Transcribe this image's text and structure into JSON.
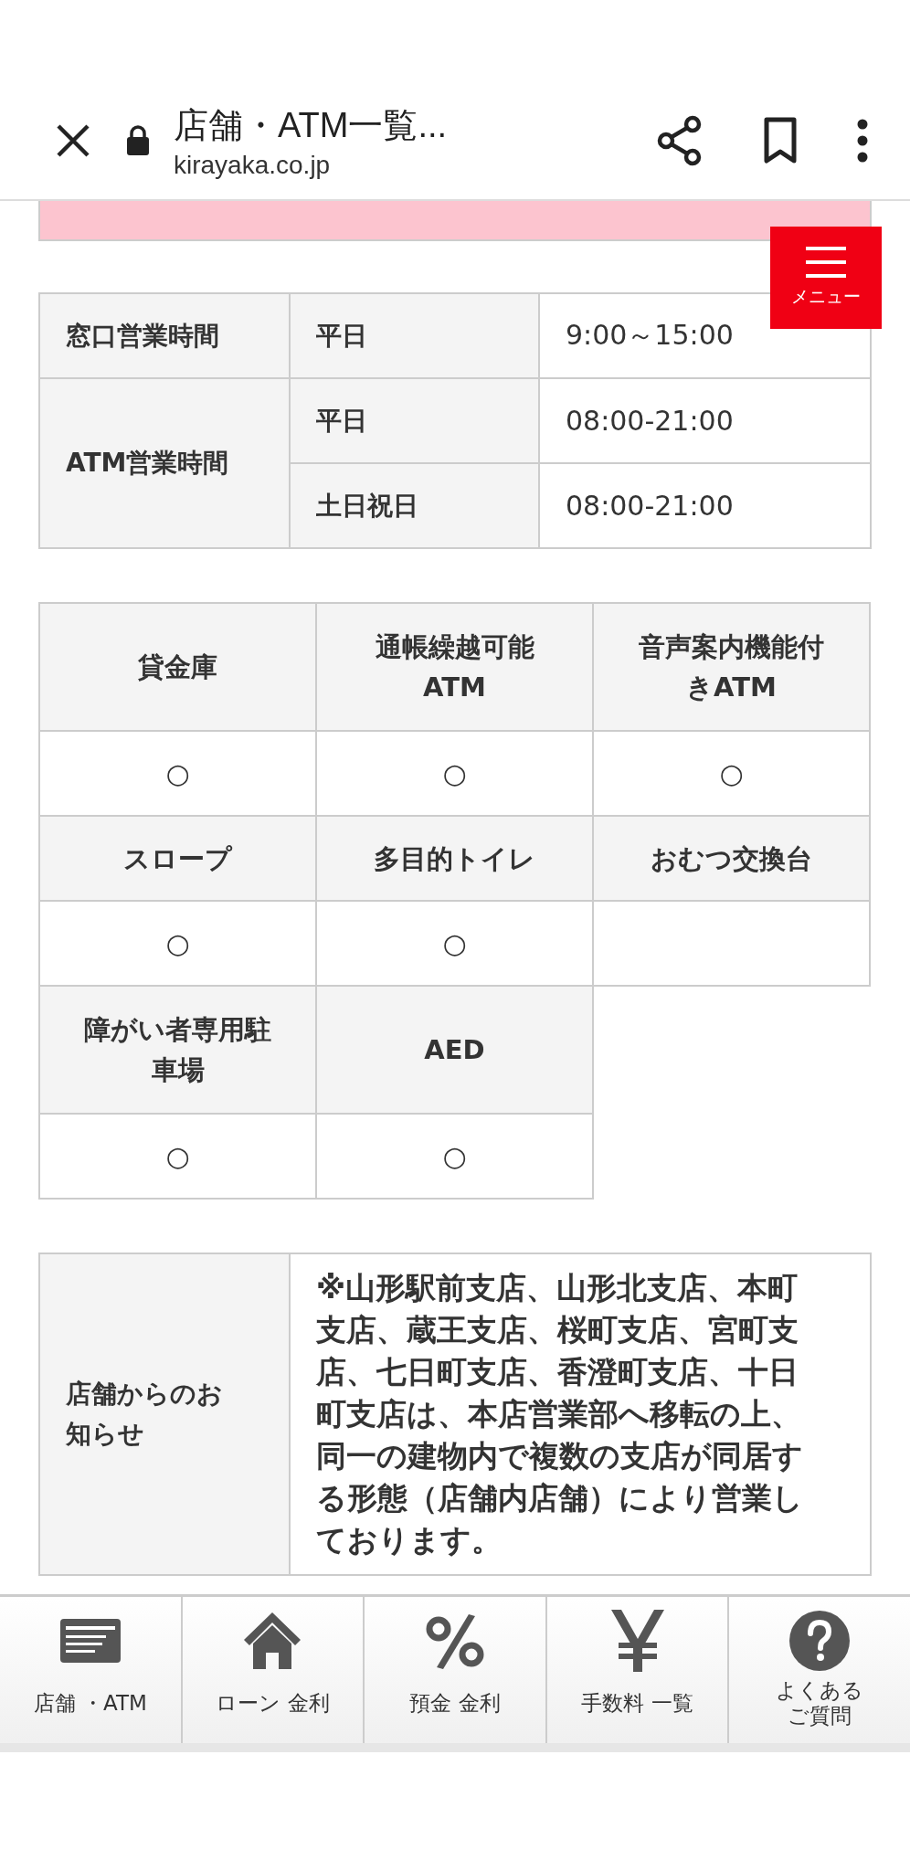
{
  "browser_bar": {
    "title": "店舗・ATM一覧...",
    "url": "kirayaka.co.jp"
  },
  "menu_button": {
    "label": "メニュー"
  },
  "hours_table": [
    {
      "label": "窓口営業時間",
      "entries": [
        {
          "day": "平日",
          "time": "9:00～15:00"
        }
      ]
    },
    {
      "label": "ATM営業時間",
      "entries": [
        {
          "day": "平日",
          "time": "08:00-21:00"
        },
        {
          "day": "土日祝日",
          "time": "08:00-21:00"
        }
      ]
    }
  ],
  "facilities": [
    {
      "name": "貸金庫",
      "mark": "○"
    },
    {
      "name": "通帳繰越可能ATM",
      "mark": "○"
    },
    {
      "name": "音声案内機能付きATM",
      "mark": "○"
    },
    {
      "name": "スロープ",
      "mark": "○"
    },
    {
      "name": "多目的トイレ",
      "mark": "○"
    },
    {
      "name": "おむつ交換台"
    },
    {
      "name": "障がい者専用駐車場",
      "mark": "○"
    },
    {
      "name": "AED",
      "mark": "○"
    }
  ],
  "notice": {
    "label": "店舗からのお知らせ",
    "text": "※山形駅前支店、山形北支店、本町支店、蔵王支店、桜町支店、宮町支店、七日町支店、香澄町支店、十日町支店は、本店営業部へ移転の上、同一の建物内で複数の支店が同居する形態（店舗内店舗）により営業しております。"
  },
  "bottom_nav": [
    {
      "kind": "card",
      "label": "店舗 ・ATM"
    },
    {
      "kind": "house",
      "label": "ローン 金利"
    },
    {
      "kind": "percent",
      "label": "預金 金利"
    },
    {
      "kind": "yen",
      "label": "手数料 一覧"
    },
    {
      "kind": "question",
      "label": "よくあるご質問"
    }
  ]
}
